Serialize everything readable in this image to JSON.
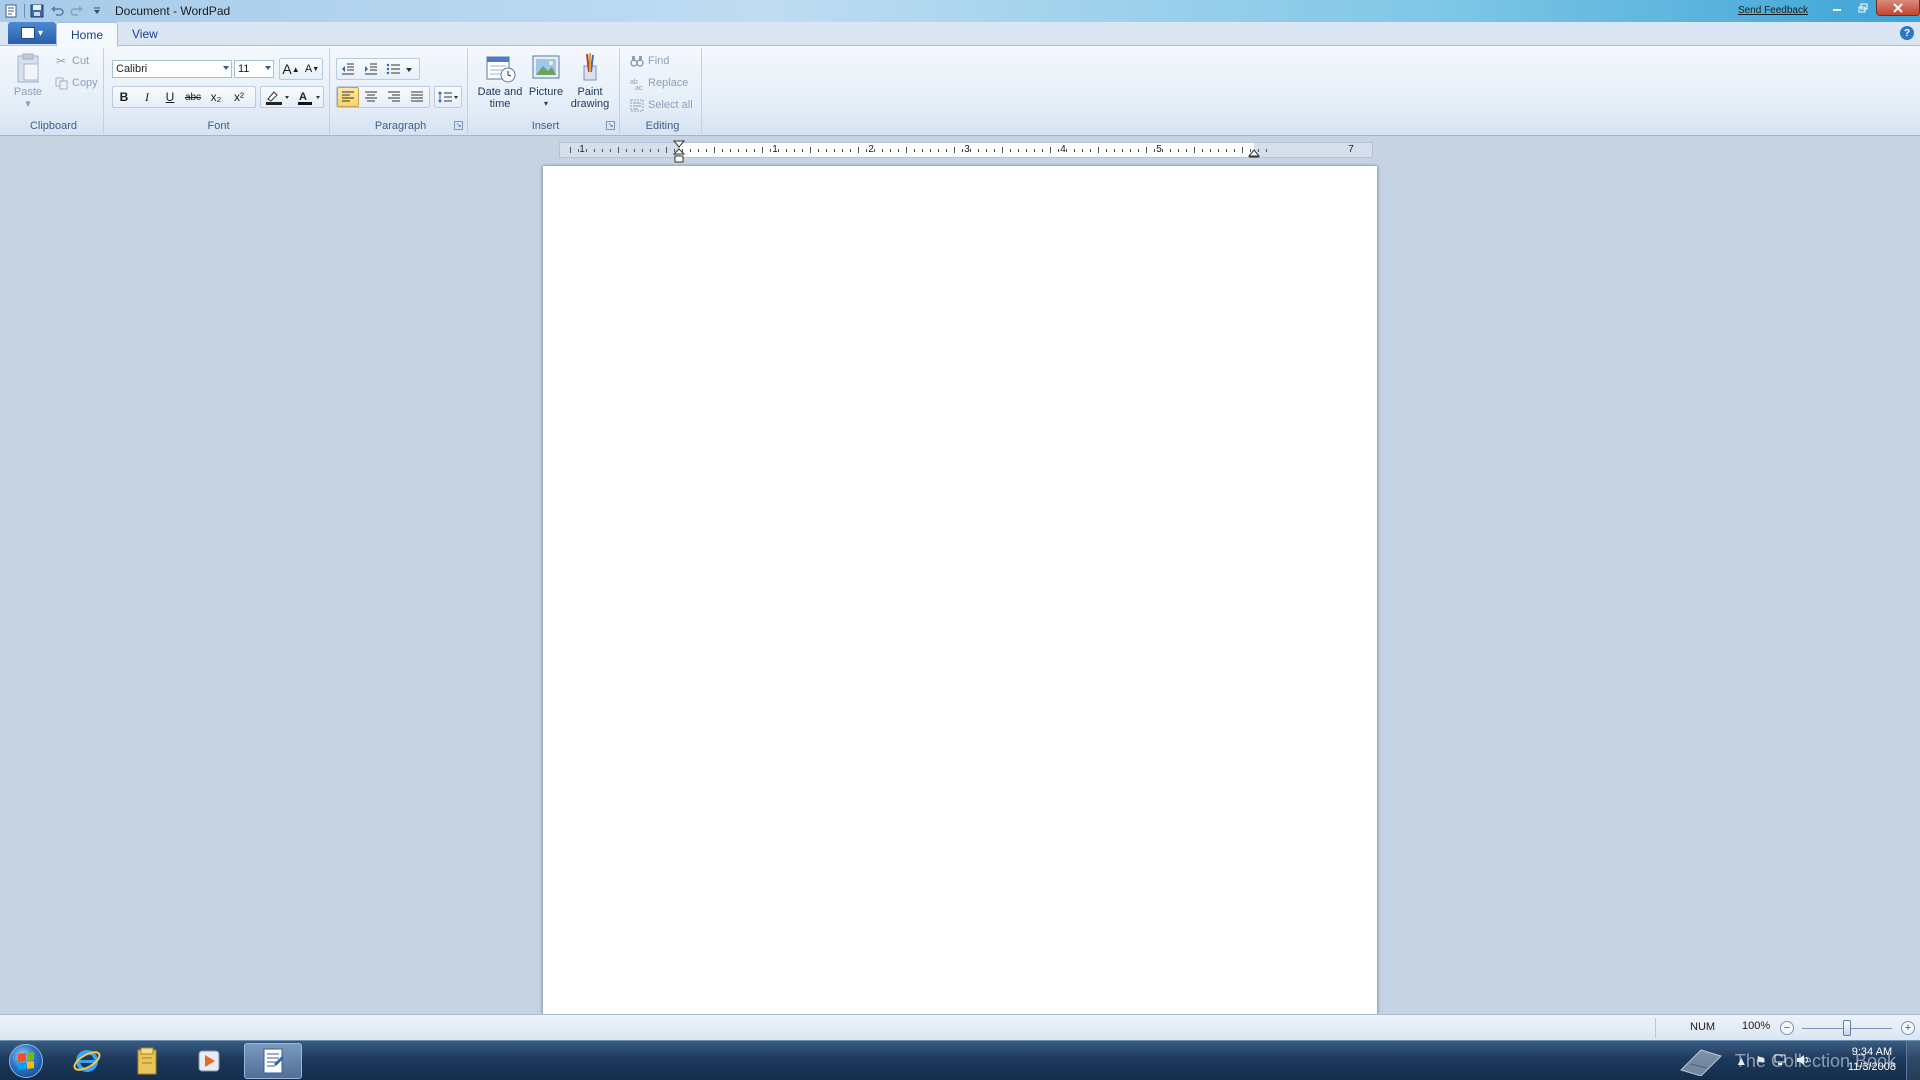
{
  "window": {
    "title": "Document - WordPad",
    "send_feedback": "Send Feedback"
  },
  "tabs": [
    {
      "label": "Home",
      "active": true
    },
    {
      "label": "View",
      "active": false
    }
  ],
  "ribbon": {
    "clipboard": {
      "label": "Clipboard",
      "paste": "Paste",
      "cut": "Cut",
      "copy": "Copy"
    },
    "font": {
      "label": "Font",
      "family": "Calibri",
      "size": "11",
      "bold": "B",
      "italic": "I",
      "underline": "U",
      "strikethrough": "abc",
      "subscript": "x₂",
      "superscript": "x²",
      "grow": "A",
      "shrink": "A"
    },
    "paragraph": {
      "label": "Paragraph"
    },
    "insert": {
      "label": "Insert",
      "date_time": [
        "Date and",
        "time"
      ],
      "picture": "Picture",
      "paint": [
        "Paint",
        "drawing"
      ]
    },
    "editing": {
      "label": "Editing",
      "find": "Find",
      "replace": "Replace",
      "select_all": "Select all"
    }
  },
  "ruler": {
    "labels": [
      "1",
      "1",
      "2",
      "3",
      "4",
      "5",
      "7"
    ]
  },
  "status": {
    "num": "NUM",
    "zoom": "100%",
    "zoom_level": 0.5
  },
  "taskbar": {
    "apps": [
      "internet-explorer",
      "file-explorer",
      "media-player",
      "wordpad"
    ],
    "active_app": "wordpad",
    "time": "9:34 AM",
    "date": "11/3/2008",
    "watermark": "The Collection Book"
  },
  "colors": {
    "accent": "#2660ad",
    "workspace": "#c6d3e3",
    "taskbar": "#1d3a5c"
  }
}
